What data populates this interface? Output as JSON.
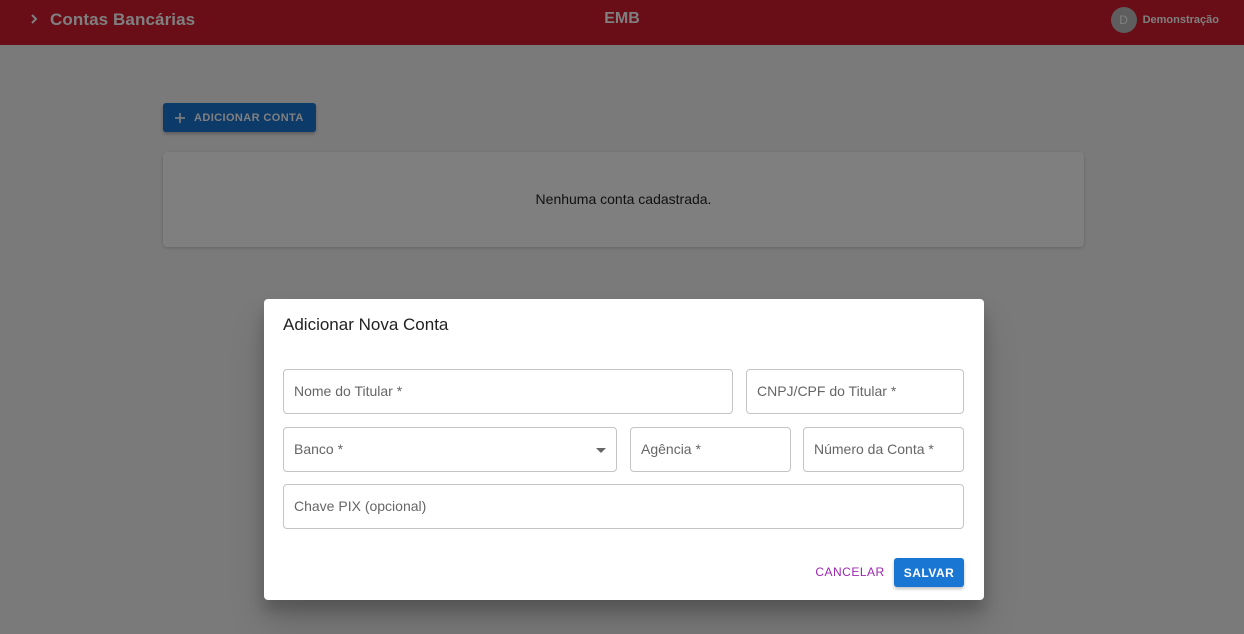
{
  "appbar": {
    "title": "Contas Bancárias",
    "center_title": "EMB",
    "user_initial": "D",
    "user_name": "Demonstração",
    "color": "#d21a2e"
  },
  "main": {
    "add_button_label": "ADICIONAR CONTA",
    "empty_message": "Nenhuma conta cadastrada."
  },
  "dialog": {
    "title": "Adicionar Nova Conta",
    "fields": {
      "holder_name": "Nome do Titular *",
      "holder_doc": "CNPJ/CPF do Titular *",
      "bank": "Banco *",
      "agency": "Agência *",
      "account_number": "Número da Conta *",
      "pix_key": "Chave PIX (opcional)"
    },
    "cancel_label": "CANCELAR",
    "save_label": "SALVAR"
  },
  "colors": {
    "primary": "#1976d2",
    "secondary": "#9c27b0"
  },
  "icons": {
    "menu_toggle": "chevron-right-icon",
    "add": "plus-icon",
    "select_arrow": "caret-down-icon"
  }
}
